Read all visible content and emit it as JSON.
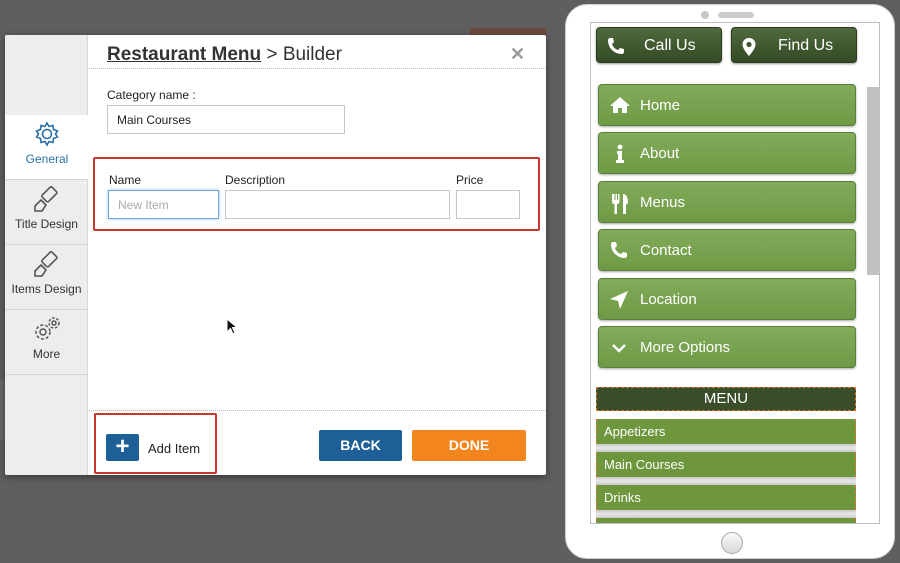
{
  "modal": {
    "title_main": "Restaurant Menu",
    "title_sep": ">",
    "title_sub": "Builder",
    "close_glyph": "✕",
    "sidebar": [
      {
        "label": "General"
      },
      {
        "label": "Title Design"
      },
      {
        "label": "Items Design"
      },
      {
        "label": "More"
      }
    ],
    "category_label": "Category name :",
    "category_value": "Main Courses",
    "item_headers": {
      "name": "Name",
      "description": "Description",
      "price": "Price"
    },
    "item_fields": {
      "name_placeholder": "New Item",
      "description_value": "",
      "price_value": ""
    },
    "add_icon": "+",
    "add_label": "Add Item",
    "back_label": "BACK",
    "done_label": "DONE"
  },
  "phone": {
    "call_label": "Call Us",
    "find_label": "Find Us",
    "nav": [
      "Home",
      "About",
      "Menus",
      "Contact",
      "Location",
      "More Options"
    ],
    "menu_heading": "MENU",
    "menu_items": [
      "Appetizers",
      "Main Courses",
      "Drinks"
    ]
  },
  "colors": {
    "accent_blue": "#1f5f97",
    "done_orange": "#f3851f",
    "highlight_red": "#c8372d",
    "nav_green": "#6e9a45",
    "dark_green": "#3b4e2a"
  }
}
